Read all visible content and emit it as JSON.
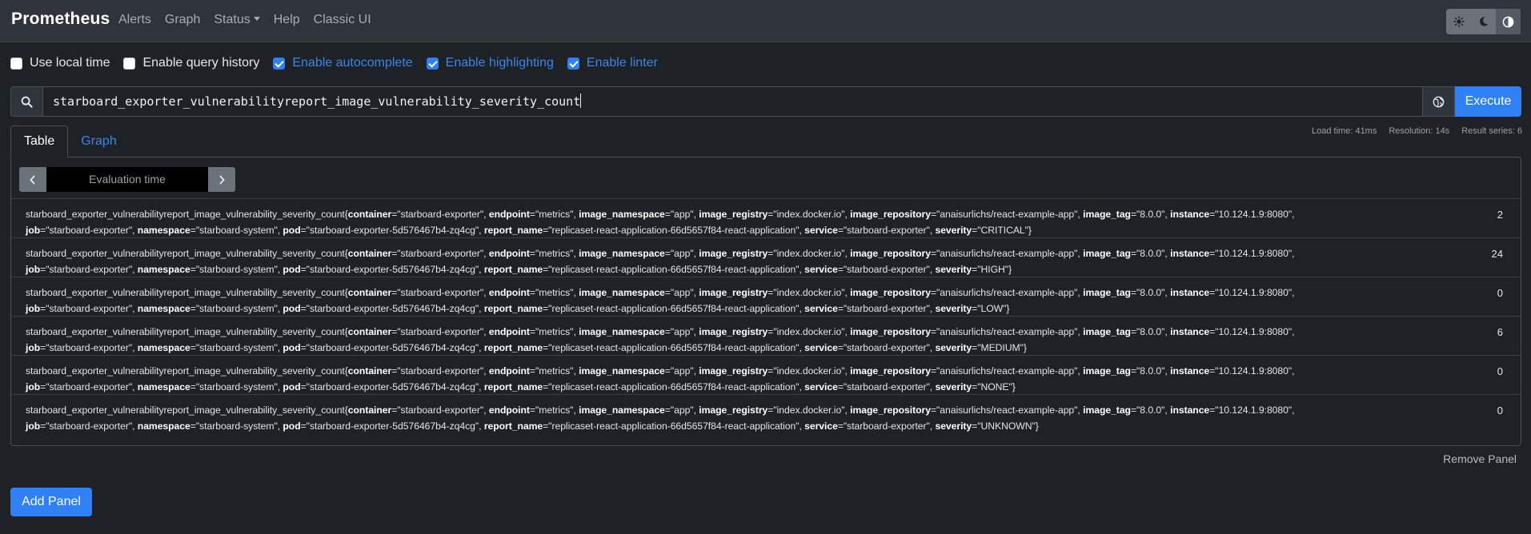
{
  "navbar": {
    "brand": "Prometheus",
    "links": [
      "Alerts",
      "Graph",
      "Status",
      "Help",
      "Classic UI"
    ]
  },
  "options": [
    {
      "label": "Use local time",
      "checked": false
    },
    {
      "label": "Enable query history",
      "checked": false
    },
    {
      "label": "Enable autocomplete",
      "checked": true
    },
    {
      "label": "Enable highlighting",
      "checked": true
    },
    {
      "label": "Enable linter",
      "checked": true
    }
  ],
  "query": {
    "value": "starboard_exporter_vulnerabilityreport_image_vulnerability_severity_count",
    "execute_label": "Execute"
  },
  "stats": {
    "load_time": "Load time: 41ms",
    "resolution": "Resolution: 14s",
    "result_series": "Result series: 6"
  },
  "tabs": {
    "table": "Table",
    "graph": "Graph"
  },
  "eval_time": {
    "placeholder": "Evaluation time"
  },
  "results": [
    {
      "metric": "starboard_exporter_vulnerabilityreport_image_vulnerability_severity_count",
      "labels": {
        "container": "starboard-exporter",
        "endpoint": "metrics",
        "image_namespace": "app",
        "image_registry": "index.docker.io",
        "image_repository": "anaisurlichs/react-example-app",
        "image_tag": "8.0.0",
        "instance": "10.124.1.9:8080",
        "job": "starboard-exporter",
        "namespace": "starboard-system",
        "pod": "starboard-exporter-5d576467b4-zq4cg",
        "report_name": "replicaset-react-application-66d5657f84-react-application",
        "service": "starboard-exporter",
        "severity": "CRITICAL"
      },
      "value": "2"
    },
    {
      "metric": "starboard_exporter_vulnerabilityreport_image_vulnerability_severity_count",
      "labels": {
        "container": "starboard-exporter",
        "endpoint": "metrics",
        "image_namespace": "app",
        "image_registry": "index.docker.io",
        "image_repository": "anaisurlichs/react-example-app",
        "image_tag": "8.0.0",
        "instance": "10.124.1.9:8080",
        "job": "starboard-exporter",
        "namespace": "starboard-system",
        "pod": "starboard-exporter-5d576467b4-zq4cg",
        "report_name": "replicaset-react-application-66d5657f84-react-application",
        "service": "starboard-exporter",
        "severity": "HIGH"
      },
      "value": "24"
    },
    {
      "metric": "starboard_exporter_vulnerabilityreport_image_vulnerability_severity_count",
      "labels": {
        "container": "starboard-exporter",
        "endpoint": "metrics",
        "image_namespace": "app",
        "image_registry": "index.docker.io",
        "image_repository": "anaisurlichs/react-example-app",
        "image_tag": "8.0.0",
        "instance": "10.124.1.9:8080",
        "job": "starboard-exporter",
        "namespace": "starboard-system",
        "pod": "starboard-exporter-5d576467b4-zq4cg",
        "report_name": "replicaset-react-application-66d5657f84-react-application",
        "service": "starboard-exporter",
        "severity": "LOW"
      },
      "value": "0"
    },
    {
      "metric": "starboard_exporter_vulnerabilityreport_image_vulnerability_severity_count",
      "labels": {
        "container": "starboard-exporter",
        "endpoint": "metrics",
        "image_namespace": "app",
        "image_registry": "index.docker.io",
        "image_repository": "anaisurlichs/react-example-app",
        "image_tag": "8.0.0",
        "instance": "10.124.1.9:8080",
        "job": "starboard-exporter",
        "namespace": "starboard-system",
        "pod": "starboard-exporter-5d576467b4-zq4cg",
        "report_name": "replicaset-react-application-66d5657f84-react-application",
        "service": "starboard-exporter",
        "severity": "MEDIUM"
      },
      "value": "6"
    },
    {
      "metric": "starboard_exporter_vulnerabilityreport_image_vulnerability_severity_count",
      "labels": {
        "container": "starboard-exporter",
        "endpoint": "metrics",
        "image_namespace": "app",
        "image_registry": "index.docker.io",
        "image_repository": "anaisurlichs/react-example-app",
        "image_tag": "8.0.0",
        "instance": "10.124.1.9:8080",
        "job": "starboard-exporter",
        "namespace": "starboard-system",
        "pod": "starboard-exporter-5d576467b4-zq4cg",
        "report_name": "replicaset-react-application-66d5657f84-react-application",
        "service": "starboard-exporter",
        "severity": "NONE"
      },
      "value": "0"
    },
    {
      "metric": "starboard_exporter_vulnerabilityreport_image_vulnerability_severity_count",
      "labels": {
        "container": "starboard-exporter",
        "endpoint": "metrics",
        "image_namespace": "app",
        "image_registry": "index.docker.io",
        "image_repository": "anaisurlichs/react-example-app",
        "image_tag": "8.0.0",
        "instance": "10.124.1.9:8080",
        "job": "starboard-exporter",
        "namespace": "starboard-system",
        "pod": "starboard-exporter-5d576467b4-zq4cg",
        "report_name": "replicaset-react-application-66d5657f84-react-application",
        "service": "starboard-exporter",
        "severity": "UNKNOWN"
      },
      "value": "0"
    }
  ],
  "remove_panel": "Remove Panel",
  "add_panel": "Add Panel",
  "icons": {
    "theme": [
      "sun-icon",
      "moon-icon",
      "contrast-icon"
    ],
    "search": "search-icon",
    "globe": "globe-icon",
    "prev": "chevron-left-icon",
    "next": "chevron-right-icon"
  },
  "colors": {
    "accent": "#2f7ff5",
    "link": "#3b86e8",
    "background": "#1e2126",
    "navbar": "#2f333a"
  }
}
